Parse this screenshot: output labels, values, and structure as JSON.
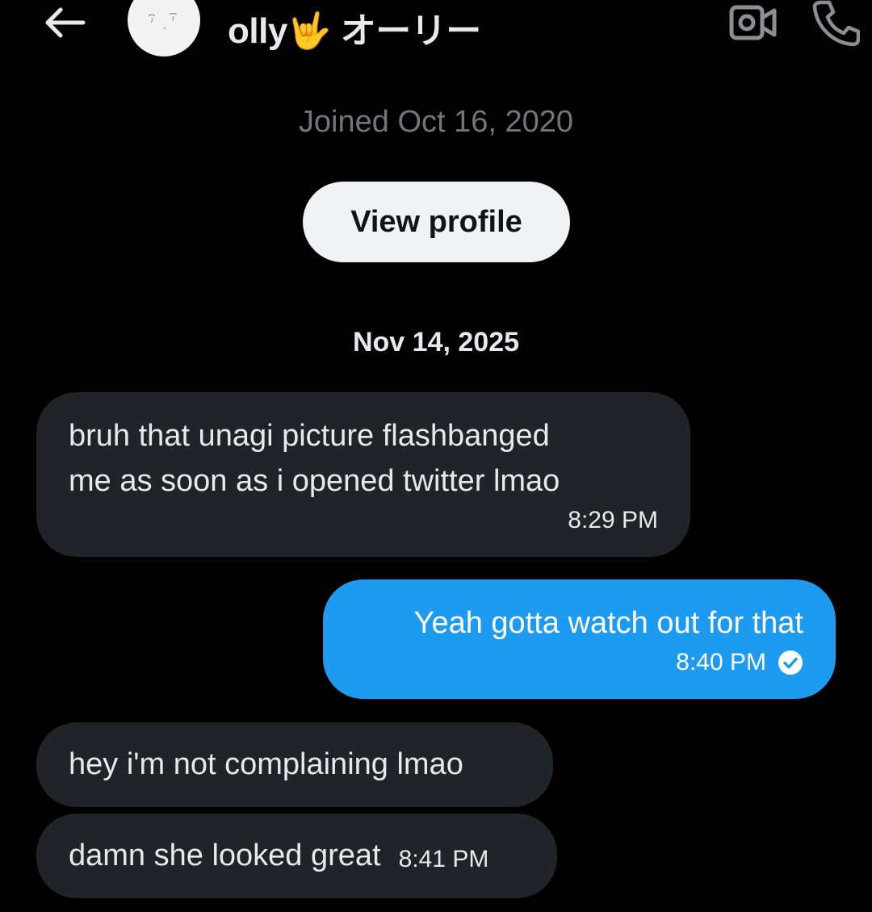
{
  "header": {
    "name": "olly🤟 オーリー",
    "back_icon": "arrow-left-icon",
    "video_icon": "video-camera-icon",
    "call_icon": "phone-icon"
  },
  "intro": {
    "joined_text": "Joined Oct 16, 2020",
    "view_profile_label": "View profile"
  },
  "conversation": {
    "date_separator": "Nov 14, 2025",
    "messages": [
      {
        "direction": "incoming",
        "lines": [
          "bruh that unagi picture flashbanged",
          "me as soon as i opened twitter lmao"
        ],
        "time": "8:29 PM"
      },
      {
        "direction": "outgoing",
        "text": "Yeah gotta watch out for that",
        "time": "8:40 PM",
        "status_icon": "read-check-icon"
      },
      {
        "direction": "incoming",
        "text": "hey i'm not complaining lmao"
      },
      {
        "direction": "incoming",
        "text": "damn she looked great",
        "time": "8:41 PM"
      }
    ]
  },
  "colors": {
    "background": "#000000",
    "incoming_bubble": "#202327",
    "outgoing_bubble": "#1d9bf0",
    "muted_text": "#71767b",
    "primary_text": "#e7e9ea"
  }
}
